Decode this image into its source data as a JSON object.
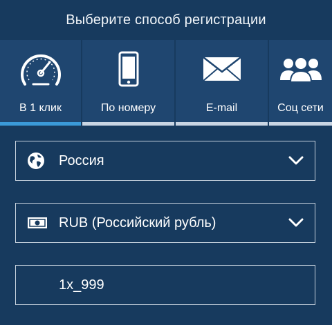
{
  "header": {
    "title": "Выберите способ регистрации"
  },
  "tabs": [
    {
      "label": "В 1 клик",
      "icon": "speedometer-icon",
      "active": true
    },
    {
      "label": "По номеру",
      "icon": "smartphone-icon",
      "active": false
    },
    {
      "label": "E-mail",
      "icon": "envelope-icon",
      "active": false
    },
    {
      "label": "Соц сети",
      "icon": "people-group-icon",
      "active": false
    }
  ],
  "form": {
    "country": {
      "value": "Россия",
      "icon": "globe-icon"
    },
    "currency": {
      "value": "RUB (Российский рубль)",
      "icon": "banknote-icon"
    },
    "promo": {
      "value": "1x_999"
    }
  },
  "colors": {
    "background": "#173a5e",
    "tab_background": "#1f4670",
    "active_indicator": "#3b9ad9",
    "inactive_indicator": "#c9d5e3"
  }
}
